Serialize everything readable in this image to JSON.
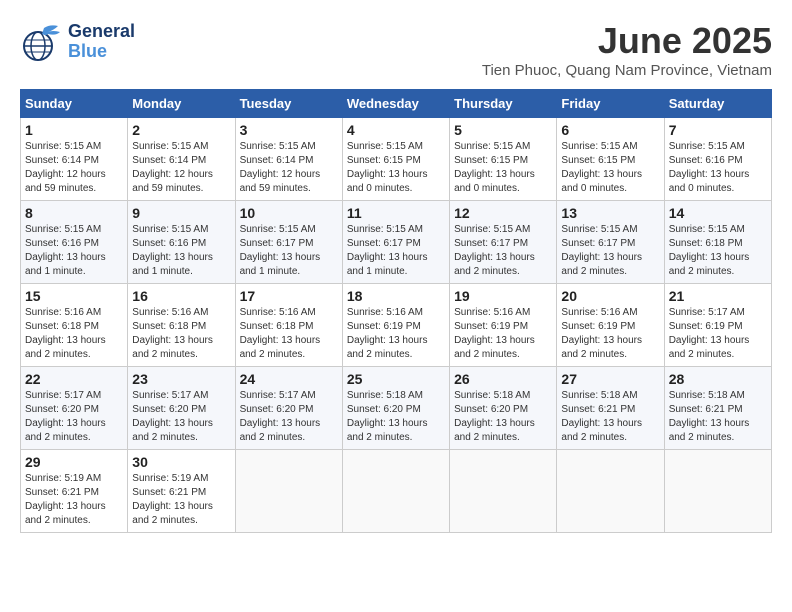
{
  "logo": {
    "line1": "General",
    "line2": "Blue"
  },
  "title": "June 2025",
  "location": "Tien Phuoc, Quang Nam Province, Vietnam",
  "weekdays": [
    "Sunday",
    "Monday",
    "Tuesday",
    "Wednesday",
    "Thursday",
    "Friday",
    "Saturday"
  ],
  "days": [
    {
      "date": "1",
      "sunrise": "Sunrise: 5:15 AM",
      "sunset": "Sunset: 6:14 PM",
      "daylight": "Daylight: 12 hours and 59 minutes."
    },
    {
      "date": "2",
      "sunrise": "Sunrise: 5:15 AM",
      "sunset": "Sunset: 6:14 PM",
      "daylight": "Daylight: 12 hours and 59 minutes."
    },
    {
      "date": "3",
      "sunrise": "Sunrise: 5:15 AM",
      "sunset": "Sunset: 6:14 PM",
      "daylight": "Daylight: 12 hours and 59 minutes."
    },
    {
      "date": "4",
      "sunrise": "Sunrise: 5:15 AM",
      "sunset": "Sunset: 6:15 PM",
      "daylight": "Daylight: 13 hours and 0 minutes."
    },
    {
      "date": "5",
      "sunrise": "Sunrise: 5:15 AM",
      "sunset": "Sunset: 6:15 PM",
      "daylight": "Daylight: 13 hours and 0 minutes."
    },
    {
      "date": "6",
      "sunrise": "Sunrise: 5:15 AM",
      "sunset": "Sunset: 6:15 PM",
      "daylight": "Daylight: 13 hours and 0 minutes."
    },
    {
      "date": "7",
      "sunrise": "Sunrise: 5:15 AM",
      "sunset": "Sunset: 6:16 PM",
      "daylight": "Daylight: 13 hours and 0 minutes."
    },
    {
      "date": "8",
      "sunrise": "Sunrise: 5:15 AM",
      "sunset": "Sunset: 6:16 PM",
      "daylight": "Daylight: 13 hours and 1 minute."
    },
    {
      "date": "9",
      "sunrise": "Sunrise: 5:15 AM",
      "sunset": "Sunset: 6:16 PM",
      "daylight": "Daylight: 13 hours and 1 minute."
    },
    {
      "date": "10",
      "sunrise": "Sunrise: 5:15 AM",
      "sunset": "Sunset: 6:17 PM",
      "daylight": "Daylight: 13 hours and 1 minute."
    },
    {
      "date": "11",
      "sunrise": "Sunrise: 5:15 AM",
      "sunset": "Sunset: 6:17 PM",
      "daylight": "Daylight: 13 hours and 1 minute."
    },
    {
      "date": "12",
      "sunrise": "Sunrise: 5:15 AM",
      "sunset": "Sunset: 6:17 PM",
      "daylight": "Daylight: 13 hours and 2 minutes."
    },
    {
      "date": "13",
      "sunrise": "Sunrise: 5:15 AM",
      "sunset": "Sunset: 6:17 PM",
      "daylight": "Daylight: 13 hours and 2 minutes."
    },
    {
      "date": "14",
      "sunrise": "Sunrise: 5:15 AM",
      "sunset": "Sunset: 6:18 PM",
      "daylight": "Daylight: 13 hours and 2 minutes."
    },
    {
      "date": "15",
      "sunrise": "Sunrise: 5:16 AM",
      "sunset": "Sunset: 6:18 PM",
      "daylight": "Daylight: 13 hours and 2 minutes."
    },
    {
      "date": "16",
      "sunrise": "Sunrise: 5:16 AM",
      "sunset": "Sunset: 6:18 PM",
      "daylight": "Daylight: 13 hours and 2 minutes."
    },
    {
      "date": "17",
      "sunrise": "Sunrise: 5:16 AM",
      "sunset": "Sunset: 6:18 PM",
      "daylight": "Daylight: 13 hours and 2 minutes."
    },
    {
      "date": "18",
      "sunrise": "Sunrise: 5:16 AM",
      "sunset": "Sunset: 6:19 PM",
      "daylight": "Daylight: 13 hours and 2 minutes."
    },
    {
      "date": "19",
      "sunrise": "Sunrise: 5:16 AM",
      "sunset": "Sunset: 6:19 PM",
      "daylight": "Daylight: 13 hours and 2 minutes."
    },
    {
      "date": "20",
      "sunrise": "Sunrise: 5:16 AM",
      "sunset": "Sunset: 6:19 PM",
      "daylight": "Daylight: 13 hours and 2 minutes."
    },
    {
      "date": "21",
      "sunrise": "Sunrise: 5:17 AM",
      "sunset": "Sunset: 6:19 PM",
      "daylight": "Daylight: 13 hours and 2 minutes."
    },
    {
      "date": "22",
      "sunrise": "Sunrise: 5:17 AM",
      "sunset": "Sunset: 6:20 PM",
      "daylight": "Daylight: 13 hours and 2 minutes."
    },
    {
      "date": "23",
      "sunrise": "Sunrise: 5:17 AM",
      "sunset": "Sunset: 6:20 PM",
      "daylight": "Daylight: 13 hours and 2 minutes."
    },
    {
      "date": "24",
      "sunrise": "Sunrise: 5:17 AM",
      "sunset": "Sunset: 6:20 PM",
      "daylight": "Daylight: 13 hours and 2 minutes."
    },
    {
      "date": "25",
      "sunrise": "Sunrise: 5:18 AM",
      "sunset": "Sunset: 6:20 PM",
      "daylight": "Daylight: 13 hours and 2 minutes."
    },
    {
      "date": "26",
      "sunrise": "Sunrise: 5:18 AM",
      "sunset": "Sunset: 6:20 PM",
      "daylight": "Daylight: 13 hours and 2 minutes."
    },
    {
      "date": "27",
      "sunrise": "Sunrise: 5:18 AM",
      "sunset": "Sunset: 6:21 PM",
      "daylight": "Daylight: 13 hours and 2 minutes."
    },
    {
      "date": "28",
      "sunrise": "Sunrise: 5:18 AM",
      "sunset": "Sunset: 6:21 PM",
      "daylight": "Daylight: 13 hours and 2 minutes."
    },
    {
      "date": "29",
      "sunrise": "Sunrise: 5:19 AM",
      "sunset": "Sunset: 6:21 PM",
      "daylight": "Daylight: 13 hours and 2 minutes."
    },
    {
      "date": "30",
      "sunrise": "Sunrise: 5:19 AM",
      "sunset": "Sunset: 6:21 PM",
      "daylight": "Daylight: 13 hours and 2 minutes."
    }
  ]
}
